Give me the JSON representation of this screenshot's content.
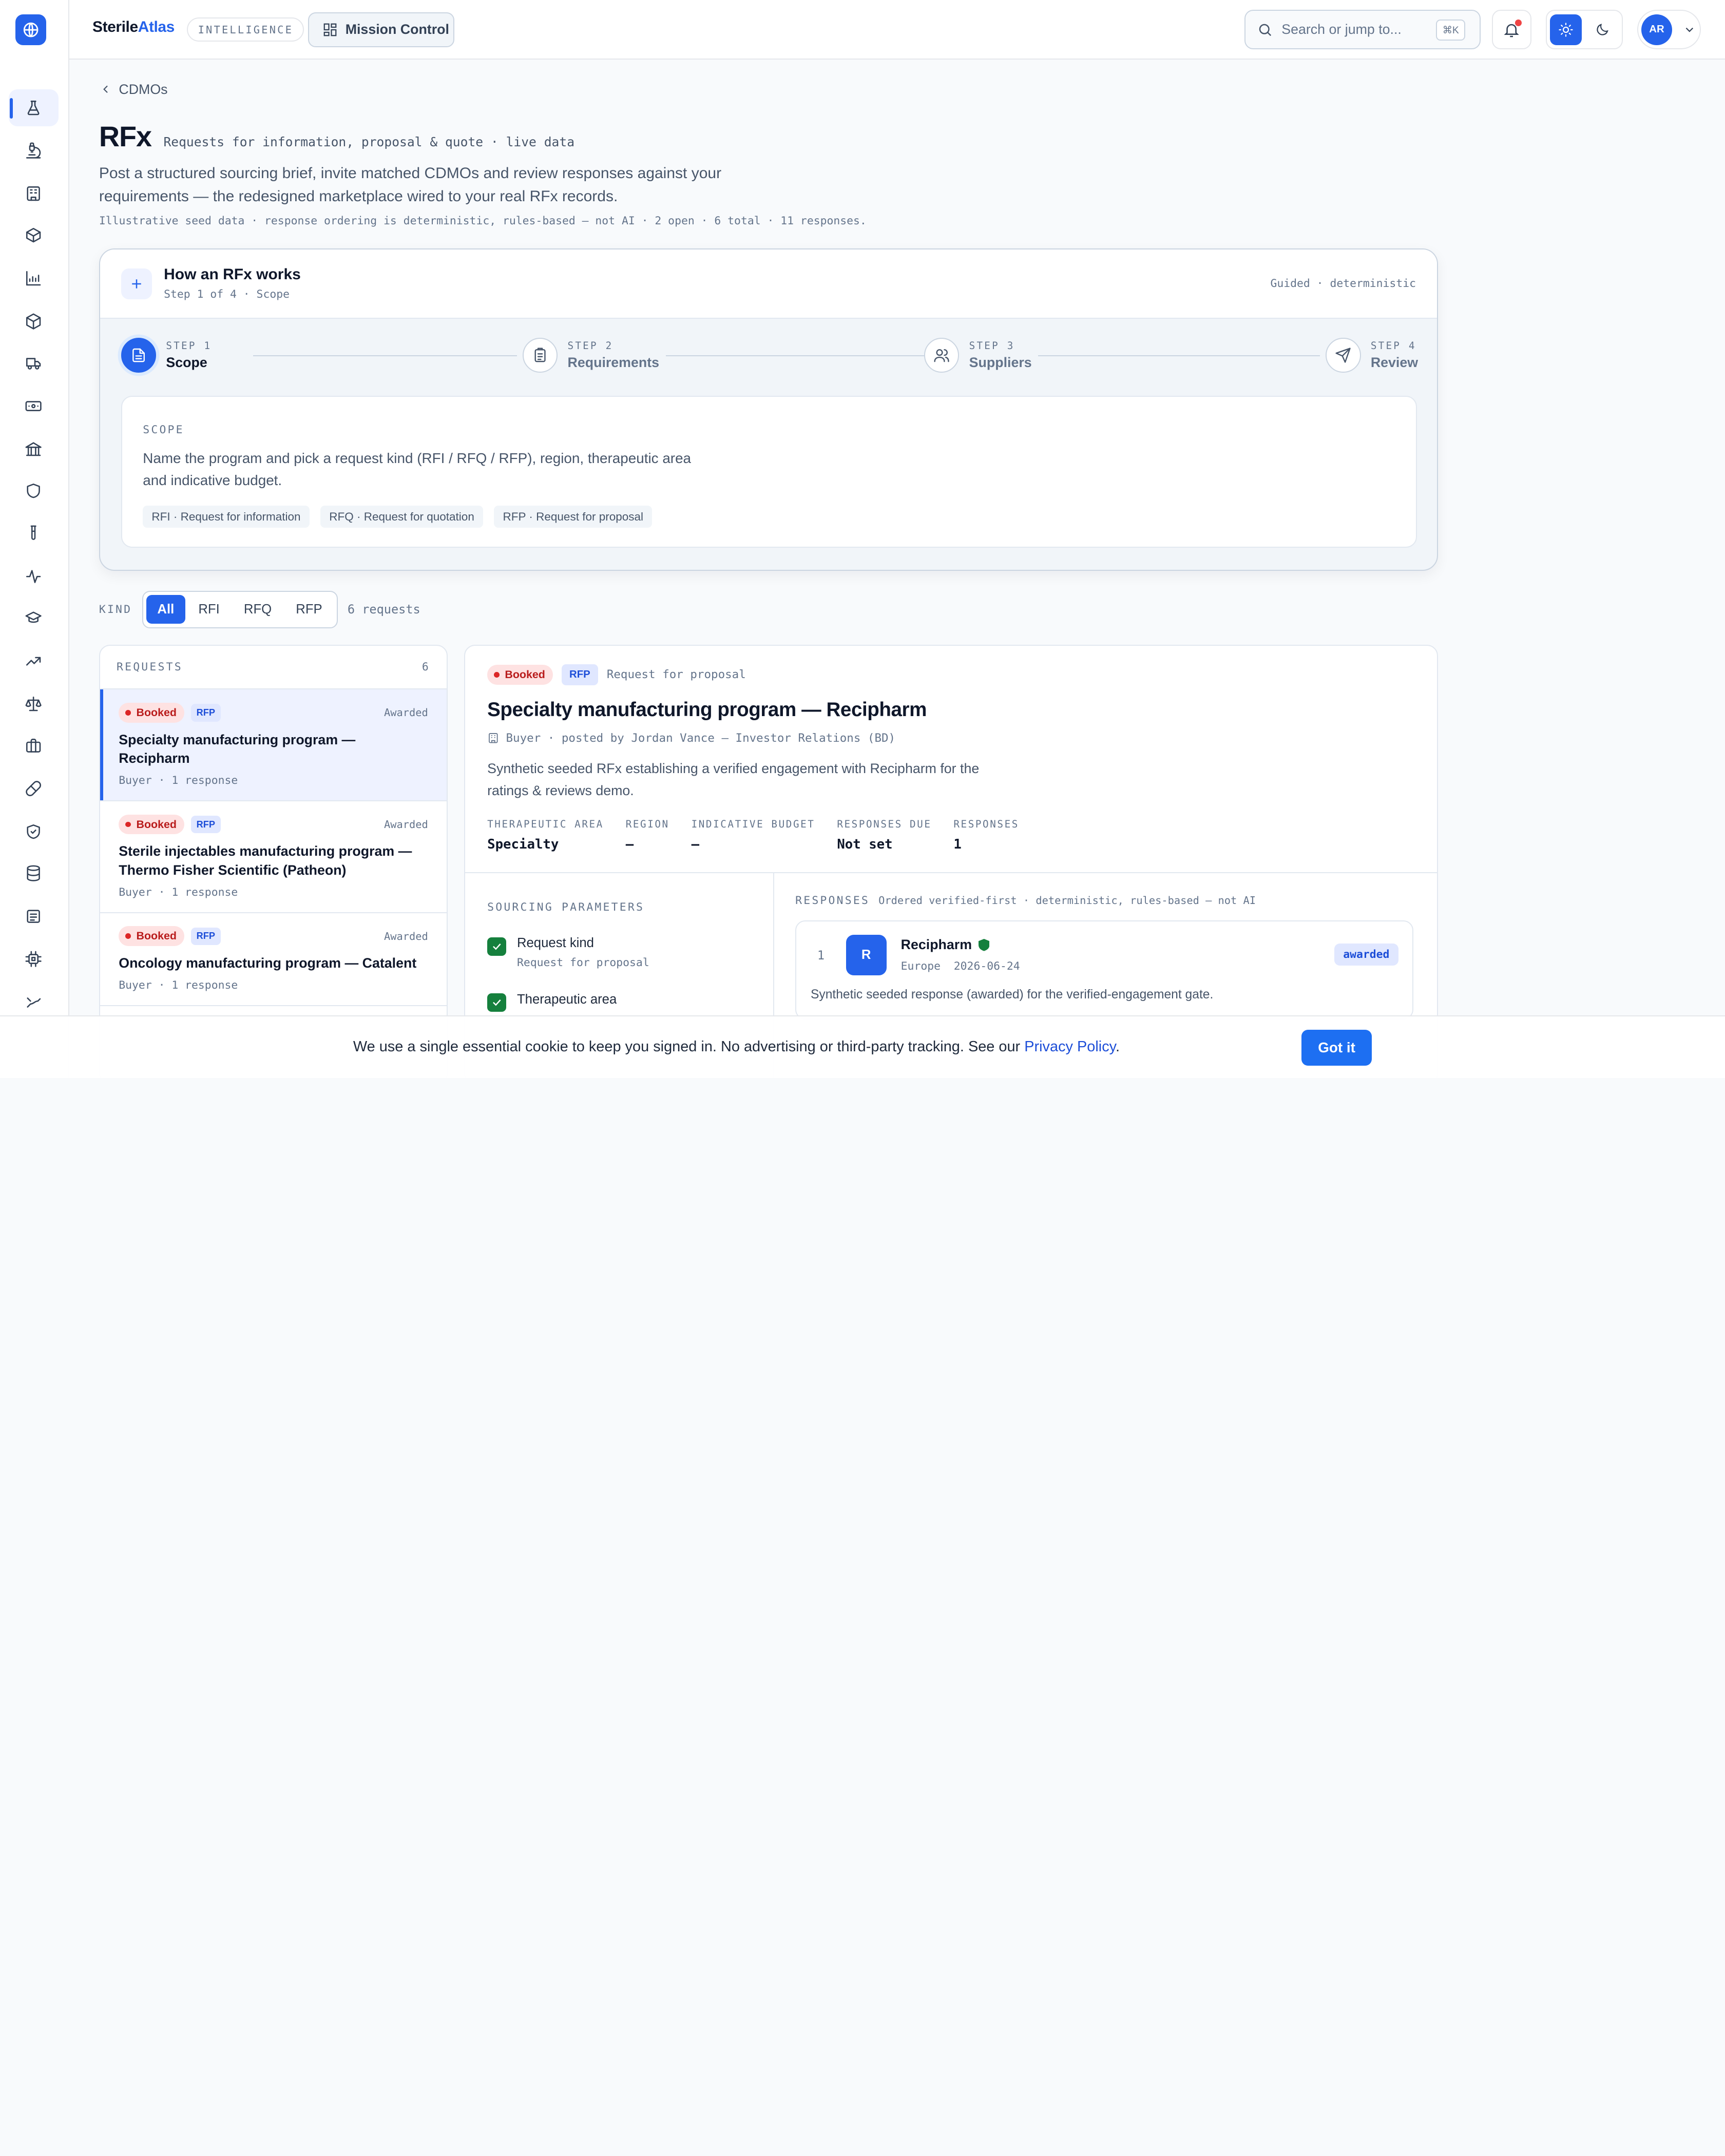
{
  "brand": {
    "name_a": "Sterile",
    "name_b": "Atlas",
    "badge": "INTELLIGENCE"
  },
  "topbar": {
    "mission_label": "Mission Control",
    "search_placeholder": "Search or jump to...",
    "search_kbd": "⌘K",
    "user_initials": "AR",
    "theme_active": "light"
  },
  "rail": {
    "icons": [
      "flask-icon",
      "microscope-icon",
      "building-icon",
      "box-icon",
      "chart-icon",
      "cube-icon",
      "truck-icon",
      "banknote-icon",
      "bank-icon",
      "shield-icon",
      "test-tube-icon",
      "activity-icon",
      "graduation-icon",
      "trending-icon",
      "scale-icon",
      "briefcase-icon",
      "pill-icon",
      "shield-check-icon",
      "database-icon",
      "ledger-icon",
      "cpu-icon",
      "route-icon"
    ],
    "active": "flask-icon"
  },
  "page": {
    "breadcrumb": "CDMOs",
    "title": "RFx",
    "subtitle": "Requests for information, proposal & quote · live data",
    "lead": "Post a structured sourcing brief, invite matched CDMOs and review responses against your requirements — the redesigned marketplace wired to your real RFx records.",
    "meta": "Illustrative seed data · response ordering is deterministic, rules-based — not AI · 2 open · 6 total · 11 responses."
  },
  "how": {
    "title": "How an RFx works",
    "sub": "Step 1 of 4 · Scope",
    "right": "Guided · deterministic",
    "steps": [
      {
        "k": "STEP 1",
        "n": "Scope"
      },
      {
        "k": "STEP 2",
        "n": "Requirements"
      },
      {
        "k": "STEP 3",
        "n": "Suppliers"
      },
      {
        "k": "STEP 4",
        "n": "Review"
      }
    ],
    "scope_k": "SCOPE",
    "scope_text": "Name the program and pick a request kind (RFI / RFQ / RFP), region, therapeutic area and indicative budget.",
    "chips": [
      "RFI · Request for information",
      "RFQ · Request for quotation",
      "RFP · Request for proposal"
    ]
  },
  "kind": {
    "label": "KIND",
    "options": [
      "All",
      "RFI",
      "RFQ",
      "RFP"
    ],
    "selected": "All",
    "count": "6 requests"
  },
  "requests": {
    "header": "REQUESTS",
    "count": "6",
    "items": [
      {
        "status_badge": "Booked",
        "kind": "RFP",
        "state": "Awarded",
        "title": "Specialty manufacturing program — Recipharm",
        "meta": "Buyer · 1 response"
      },
      {
        "status_badge": "Booked",
        "kind": "RFP",
        "state": "Awarded",
        "title": "Sterile injectables manufacturing program — Thermo Fisher Scientific (Patheon)",
        "meta": "Buyer · 1 response"
      },
      {
        "status_badge": "Booked",
        "kind": "RFP",
        "state": "Awarded",
        "title": "Oncology manufacturing program — Catalent",
        "meta": "Buyer · 1 response"
      }
    ]
  },
  "detail": {
    "status_badge": "Booked",
    "kind": "RFP",
    "kind_full": "Request for proposal",
    "title": "Specialty manufacturing program — Recipharm",
    "buyer": "Buyer · posted by Jordan Vance — Investor Relations (BD)",
    "desc": "Synthetic seeded RFx establishing a verified engagement with Recipharm for the ratings & reviews demo.",
    "facts": [
      {
        "k": "THERAPEUTIC AREA",
        "v": "Specialty"
      },
      {
        "k": "REGION",
        "v": "—"
      },
      {
        "k": "INDICATIVE BUDGET",
        "v": "—"
      },
      {
        "k": "RESPONSES DUE",
        "v": "Not set"
      },
      {
        "k": "RESPONSES",
        "v": "1"
      }
    ],
    "params_label": "SOURCING PARAMETERS",
    "params": [
      {
        "k": "Request kind",
        "v": "Request for proposal"
      },
      {
        "k": "Therapeutic area",
        "v": ""
      }
    ],
    "responses_label": "RESPONSES",
    "responses_note": "Ordered verified-first · deterministic, rules-based — not AI",
    "response": {
      "rank": "1",
      "logo": "R",
      "name": "Recipharm",
      "region": "Europe",
      "date": "2026-06-24",
      "status": "awarded",
      "text": "Synthetic seeded response (awarded) for the verified-engagement gate."
    }
  },
  "cookie": {
    "text": "We use a single essential cookie to keep you signed in. No advertising or third-party tracking. See our ",
    "link": "Privacy Policy",
    "end": ".",
    "button": "Got it"
  }
}
